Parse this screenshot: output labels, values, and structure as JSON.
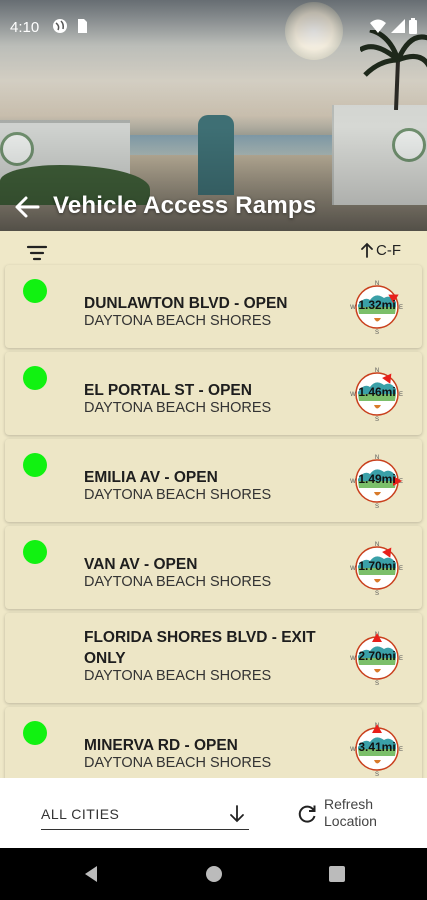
{
  "status_bar": {
    "time": "4:10"
  },
  "header": {
    "title": "Vehicle Access Ramps"
  },
  "toolbar": {
    "sort_label": "C-F"
  },
  "ramps": [
    {
      "name": "DUNLAWTON BLVD - OPEN",
      "city": "DAYTONA BEACH SHORES",
      "distance": "1.32mi",
      "status_color": "#11f211",
      "show_dot": true,
      "arrow_deg": 60
    },
    {
      "name": "EL PORTAL ST - OPEN",
      "city": "DAYTONA BEACH SHORES",
      "distance": "1.46mi",
      "status_color": "#11f211",
      "show_dot": true,
      "arrow_deg": 35
    },
    {
      "name": "EMILIA AV - OPEN",
      "city": "DAYTONA BEACH SHORES",
      "distance": "1.49mi",
      "status_color": "#11f211",
      "show_dot": true,
      "arrow_deg": 90
    },
    {
      "name": "VAN AV - OPEN",
      "city": "DAYTONA BEACH SHORES",
      "distance": "1.70mi",
      "status_color": "#11f211",
      "show_dot": true,
      "arrow_deg": 35
    },
    {
      "name": "FLORIDA SHORES BLVD - EXIT ONLY",
      "city": "DAYTONA BEACH SHORES",
      "distance": "2.70mi",
      "status_color": "#11f211",
      "show_dot": false,
      "arrow_deg": 0
    },
    {
      "name": "MINERVA RD - OPEN",
      "city": "DAYTONA BEACH SHORES",
      "distance": "3.41mi",
      "status_color": "#11f211",
      "show_dot": true,
      "arrow_deg": 0
    }
  ],
  "city_filter": {
    "value": "ALL CITIES"
  },
  "refresh": {
    "label": "Refresh Location"
  },
  "colors": {
    "accent_red": "#e8201a",
    "status_open": "#11f211",
    "background": "#efe8c8"
  }
}
